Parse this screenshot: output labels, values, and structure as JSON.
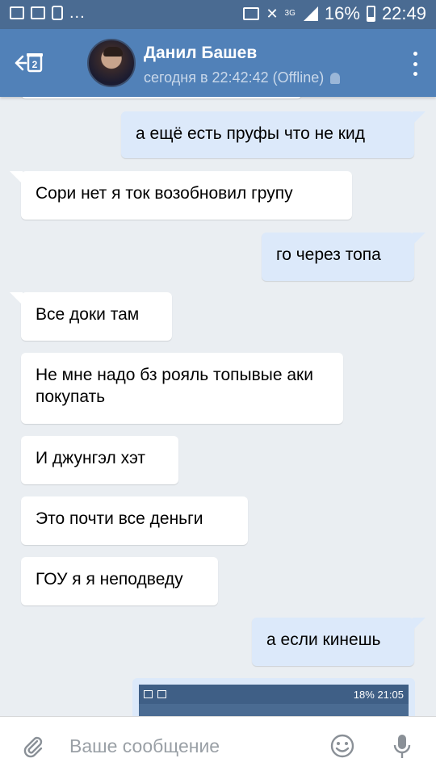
{
  "statusbar": {
    "notif_more": "...",
    "network": "3G",
    "battery": "16%",
    "time": "22:49"
  },
  "header": {
    "name": "Данил Башев",
    "status": "сегодня в 22:42:42 (Offline)",
    "unread_badge": "2"
  },
  "messages": [
    {
      "dir": "out",
      "text": "а ещё есть пруфы что не кид"
    },
    {
      "dir": "in",
      "text": "Сори нет я ток возобновил групу"
    },
    {
      "dir": "out",
      "text": "го через топа"
    },
    {
      "dir": "in",
      "text": "Все доки там"
    },
    {
      "dir": "in",
      "text": "Не мне надо бз рояль топывые аки покупать"
    },
    {
      "dir": "in",
      "text": "И джунгэл хэт"
    },
    {
      "dir": "in",
      "text": "Это почти все деньги"
    },
    {
      "dir": "in",
      "text": "ГОУ я я неподведу"
    },
    {
      "dir": "out",
      "text": "а если кинешь"
    }
  ],
  "attachment": {
    "battery": "18%",
    "time": "21:05"
  },
  "composer": {
    "placeholder": "Ваше сообщение"
  },
  "colors": {
    "header": "#5181b8",
    "statusbar": "#4a6b92",
    "outgoing_bubble": "#dce9fa",
    "incoming_bubble": "#ffffff",
    "background": "#eaeef2"
  }
}
